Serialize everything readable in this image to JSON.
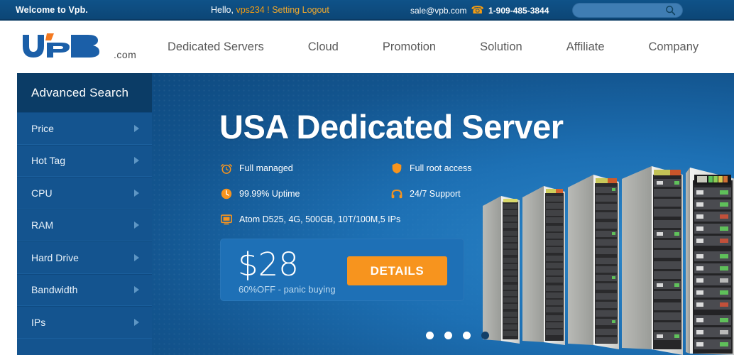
{
  "topbar": {
    "welcome": "Welcome to Vpb.",
    "hello_prefix": "Hello,",
    "username": "vps234",
    "separator": "!",
    "setting_label": "Setting",
    "logout_label": "Logout",
    "email": "sale@vpb.com",
    "phone_icon": "phone-icon",
    "phone": "1-909-485-3844",
    "search_placeholder": "",
    "search_value": "",
    "search_icon": "search-icon",
    "bg_color": "#0d4a7f",
    "accent_color": "#f39c12"
  },
  "header": {
    "logo_text": "VPB",
    "logo_suffix": ".com",
    "logo_color": "#1b5fa8",
    "logo_accent": "#f47920",
    "nav": [
      {
        "label": "Dedicated Servers",
        "name": "nav-dedicated-servers"
      },
      {
        "label": "Cloud",
        "name": "nav-cloud"
      },
      {
        "label": "Promotion",
        "name": "nav-promotion"
      },
      {
        "label": "Solution",
        "name": "nav-solution"
      },
      {
        "label": "Affiliate",
        "name": "nav-affiliate"
      },
      {
        "label": "Company",
        "name": "nav-company"
      }
    ]
  },
  "sidebar": {
    "title": "Advanced Search",
    "bg_color": "#14548f",
    "header_color": "#0b3c66",
    "items": [
      {
        "label": "Price"
      },
      {
        "label": "Hot Tag"
      },
      {
        "label": "CPU"
      },
      {
        "label": "RAM"
      },
      {
        "label": "Hard Drive"
      },
      {
        "label": "Bandwidth"
      },
      {
        "label": "IPs"
      }
    ]
  },
  "banner": {
    "title": "USA Dedicated Server",
    "features": [
      {
        "icon": "alarm-clock-icon",
        "label": "Full managed",
        "col": 1
      },
      {
        "icon": "shield-icon",
        "label": "Full root access",
        "col": 2
      },
      {
        "icon": "clock-icon",
        "label": "99.99% Uptime",
        "col": 1
      },
      {
        "icon": "headset-icon",
        "label": "24/7 Support",
        "col": 2
      },
      {
        "icon": "monitor-icon",
        "label": "Atom D525, 4G, 500GB, 10T/100M,5 IPs",
        "col": 1
      }
    ],
    "price": "$28",
    "price_note": "60%OFF - panic buying",
    "details_label": "DETAILS",
    "details_color": "#f7941e",
    "carousel": {
      "count": 4,
      "active_index": 3
    },
    "artwork": "server-racks-image"
  }
}
